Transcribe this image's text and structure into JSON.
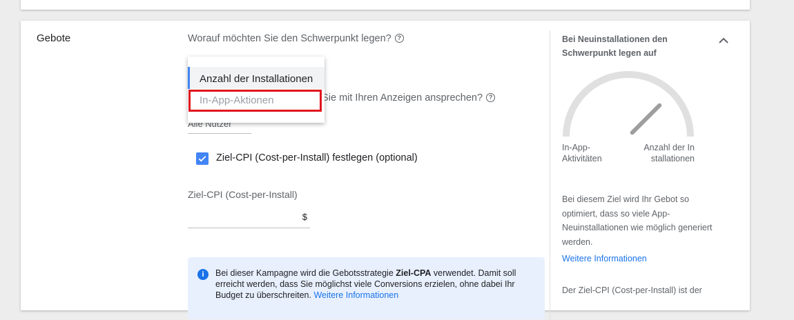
{
  "section": {
    "title": "Gebote"
  },
  "focus_question": "Worauf möchten Sie den Schwerpunkt legen?",
  "dropdown": {
    "options": [
      "Anzahl der Installationen",
      "In-App-Aktionen"
    ],
    "selected": "Anzahl der Installationen"
  },
  "users_question": "n Sie mit Ihren Anzeigen ansprechen?",
  "users_select_value": "Alle Nutzer",
  "checkbox": {
    "checked": true,
    "label": "Ziel-CPI (Cost-per-Install) festlegen (optional)"
  },
  "cpi": {
    "label": "Ziel-CPI (Cost-per-Install)",
    "currency": "$",
    "value": ""
  },
  "info": {
    "text_before": "Bei dieser Kampagne wird die Gebotsstrategie ",
    "bold": "Ziel-CPA",
    "text_after": " verwendet. Damit soll erreicht werden, dass Sie möglichst viele Conversions erzielen, ohne dabei Ihr Budget zu überschreiten. ",
    "link": "Weitere Informationen"
  },
  "panel": {
    "title": "Bei Neuinstallationen den Schwerpunkt legen auf",
    "gauge": {
      "left_label": "In-App-Aktivitäten",
      "right_label": "Anzahl der Installationen",
      "level": 0.75
    },
    "description": "Bei diesem Ziel wird Ihr Gebot so optimiert, dass so viele App-Neuinstallationen wie möglich generiert werden.",
    "link": "Weitere Informationen",
    "description2": "Der Ziel-CPI (Cost-per-Install) ist der"
  },
  "colors": {
    "accent": "#4285f4",
    "highlight": "#e0161f",
    "link": "#1a73e8",
    "info_bg": "#e8f0fe"
  }
}
